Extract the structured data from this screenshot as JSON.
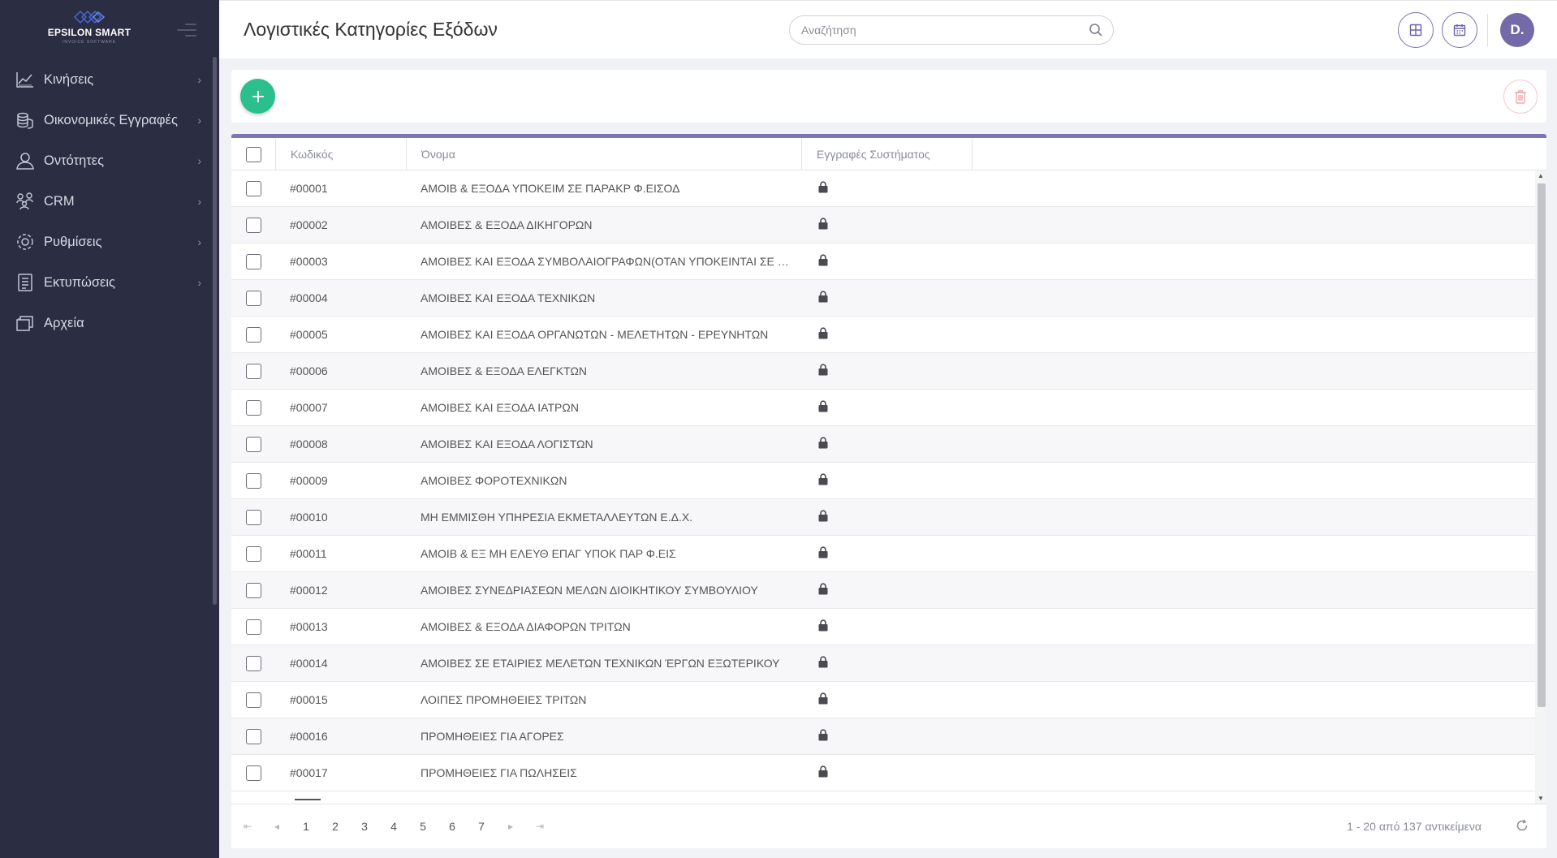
{
  "brand": {
    "name": "EPSILON SMART",
    "tagline": "INVOICE SOFTWARE",
    "logo_color": "#4660c8"
  },
  "sidebar": {
    "items": [
      {
        "label": "Κινήσεις",
        "icon": "chart-icon"
      },
      {
        "label": "Οικονομικές Εγγραφές",
        "icon": "coins-icon"
      },
      {
        "label": "Οντότητες",
        "icon": "user-icon"
      },
      {
        "label": "CRM",
        "icon": "people-icon"
      },
      {
        "label": "Ρυθμίσεις",
        "icon": "gear-icon"
      },
      {
        "label": "Εκτυπώσεις",
        "icon": "document-icon"
      },
      {
        "label": "Αρχεία",
        "icon": "files-icon"
      }
    ]
  },
  "header": {
    "title": "Λογιστικές Κατηγορίες Εξόδων",
    "search_placeholder": "Αναζήτηση",
    "avatar": "D."
  },
  "colors": {
    "accent": "#7c76b3",
    "add": "#2bbf8e",
    "delete": "#f1c9cc",
    "sidebar": "#2b2d42"
  },
  "table": {
    "columns": {
      "code": "Κωδικός",
      "name": "Όνομα",
      "system": "Εγγραφές Συστήματος"
    },
    "rows": [
      {
        "code": "#00001",
        "name": "ΑΜΟΙΒ & ΕΞΟΔΑ ΥΠΟΚΕΙΜ ΣΕ ΠΑΡΑΚΡ Φ.ΕΙΣΟΔ",
        "system": "lock-icon"
      },
      {
        "code": "#00002",
        "name": "ΑΜΟΙΒΕΣ & ΕΞΟΔΑ ΔΙΚΗΓΟΡΩΝ",
        "system": "lock-icon"
      },
      {
        "code": "#00003",
        "name": "ΑΜΟΙΒΕΣ ΚΑΙ ΕΞΟΔΑ ΣΥΜΒΟΛΑΙΟΓΡΑΦΩΝ(ΟΤΑΝ ΥΠΟΚΕΙΝΤΑΙ ΣΕ Π...",
        "system": "lock-icon"
      },
      {
        "code": "#00004",
        "name": "ΑΜΟΙΒΕΣ ΚΑΙ ΕΞΟΔΑ ΤΕΧΝΙΚΩΝ",
        "system": "lock-icon"
      },
      {
        "code": "#00005",
        "name": "ΑΜΟΙΒΕΣ ΚΑΙ ΕΞΟΔΑ ΟΡΓΑΝΩΤΩΝ - ΜΕΛΕΤΗΤΩΝ - ΕΡΕΥΝΗΤΩΝ",
        "system": "lock-icon"
      },
      {
        "code": "#00006",
        "name": "ΑΜΟΙΒΕΣ & ΕΞΟΔΑ ΕΛΕΓΚΤΩΝ",
        "system": "lock-icon"
      },
      {
        "code": "#00007",
        "name": "ΑΜΟΙΒΕΣ ΚΑΙ ΕΞΟΔΑ ΙΑΤΡΩΝ",
        "system": "lock-icon"
      },
      {
        "code": "#00008",
        "name": "ΑΜΟΙΒΕΣ ΚΑΙ ΕΞΟΔΑ ΛΟΓΙΣΤΩΝ",
        "system": "lock-icon"
      },
      {
        "code": "#00009",
        "name": "ΑΜΟΙΒΕΣ ΦΟΡΟΤΕΧΝΙΚΩΝ",
        "system": "lock-icon"
      },
      {
        "code": "#00010",
        "name": "ΜΗ ΕΜΜΙΣΘΗ ΥΠΗΡΕΣΙΑ ΕΚΜΕΤΑΛΛΕΥΤΩΝ Ε.Δ.Χ.",
        "system": "lock-icon"
      },
      {
        "code": "#00011",
        "name": "ΑΜΟΙΒ & ΕΞ ΜΗ ΕΛΕΥΘ ΕΠΑΓ ΥΠΟΚ ΠΑΡ Φ.ΕΙΣ",
        "system": "lock-icon"
      },
      {
        "code": "#00012",
        "name": "ΑΜΟΙΒΕΣ ΣΥΝΕΔΡΙΑΣΕΩΝ ΜΕΛΩΝ ΔΙΟΙΚΗΤΙΚΟΥ ΣΥΜΒΟΥΛΙΟΥ",
        "system": "lock-icon"
      },
      {
        "code": "#00013",
        "name": "ΑΜΟΙΒΕΣ & ΕΞΟΔΑ ΔΙΑΦΟΡΩΝ ΤΡΙΤΩΝ",
        "system": "lock-icon"
      },
      {
        "code": "#00014",
        "name": "ΑΜΟΙΒΕΣ ΣΕ ΕΤΑΙΡΙΕΣ ΜΕΛΕΤΩΝ ΤΕΧΝΙΚΩΝ ΈΡΓΩΝ ΕΞΩΤΕΡΙΚΟΥ",
        "system": "lock-icon"
      },
      {
        "code": "#00015",
        "name": "ΛΟΙΠΕΣ ΠΡΟΜΗΘΕΙΕΣ ΤΡΙΤΩΝ",
        "system": "lock-icon"
      },
      {
        "code": "#00016",
        "name": "ΠΡΟΜΗΘΕΙΕΣ ΓΙΑ ΑΓΟΡΕΣ",
        "system": "lock-icon"
      },
      {
        "code": "#00017",
        "name": "ΠΡΟΜΗΘΕΙΕΣ ΓΙΑ ΠΩΛΗΣΕΙΣ",
        "system": "lock-icon"
      }
    ]
  },
  "pager": {
    "pages": [
      "1",
      "2",
      "3",
      "4",
      "5",
      "6",
      "7"
    ],
    "current": "1",
    "info": "1 - 20 από 137 αντικείμενα"
  }
}
